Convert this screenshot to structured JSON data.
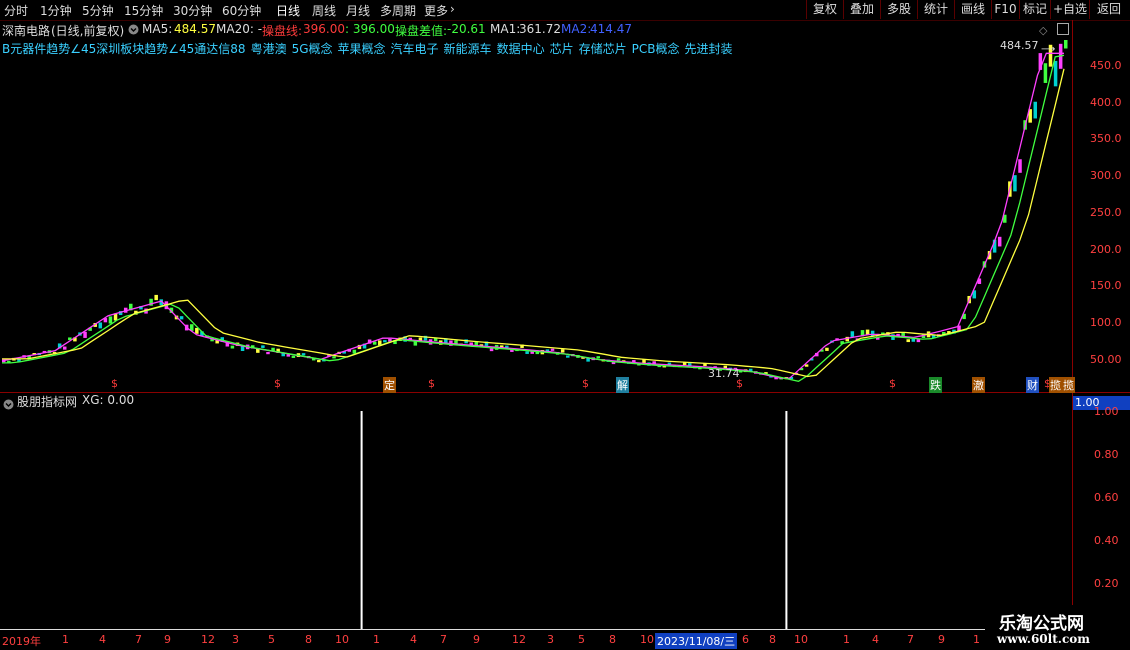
{
  "toolbar": {
    "periods": [
      "分时",
      "1分钟",
      "5分钟",
      "15分钟",
      "30分钟",
      "60分钟",
      "日线",
      "周线",
      "月线",
      "多周期",
      "更多"
    ],
    "more_arrow": "›",
    "buttons": [
      "复权",
      "叠加",
      "多股",
      "统计",
      "画线",
      "F10",
      "标记",
      "+自选",
      "返回"
    ]
  },
  "info": {
    "stock": "深南电路",
    "mode": "(日线,前复权)",
    "ma5_label": "MA5:",
    "ma5": "484.57",
    "ma20_label": "MA20: -",
    "cpl_label": "操盘线:",
    "cpl": "396.00",
    "cpl2": ": 396.00",
    "diff_label": "操盘差值:",
    "diff": "-20.61",
    "ma1_label": "MA1:",
    "ma1": "361.72",
    "ma2_label": "MA2:",
    "ma2": "414.47"
  },
  "concepts": [
    "B元器件趋势∠45深圳板块趋势∠45通达信88",
    "粤港澳",
    "5G概念",
    "苹果概念",
    "汽车电子",
    "新能源车",
    "数据中心",
    "芯片",
    "存储芯片",
    "PCB概念",
    "先进封装"
  ],
  "price_axis": [
    "450.0",
    "400.0",
    "350.0",
    "300.0",
    "250.0",
    "200.0",
    "150.0",
    "100.0",
    "50.00"
  ],
  "price_high": "484.57",
  "price_low": "31.74",
  "event_marks": [
    "$",
    "$",
    "定",
    "$",
    "$",
    "解",
    "$",
    "$",
    "跌",
    "澈",
    "财",
    "$",
    "揽",
    "揽"
  ],
  "indicator": {
    "name": "股朋指标网",
    "xg": "XG: 0.00",
    "axis": [
      "1.00",
      "0.80",
      "0.60",
      "0.40",
      "0.20"
    ],
    "current": "1.00"
  },
  "x_axis": [
    "2019年",
    "1",
    "4",
    "7",
    "9",
    "12",
    "3",
    "5",
    "8",
    "10",
    "1",
    "4",
    "7",
    "9",
    "12",
    "3",
    "5",
    "8",
    "10",
    "2023/11/08/三",
    "6",
    "8",
    "10",
    "1",
    "4",
    "7",
    "9",
    "1"
  ],
  "watermark": {
    "title": "乐淘公式网",
    "url": "www.60lt.com"
  },
  "colors": {
    "up": "#ff3b3b",
    "down": "#00d0d0",
    "ma_pink": "#ff40ff",
    "ma_green": "#40ff40",
    "ma_yellow": "#ffff40",
    "axis": "#ff4040",
    "grid": "#8a0000"
  },
  "chart_data": {
    "type": "line",
    "title": "深南电路 (日线,前复权)",
    "ylim": [
      31.74,
      484.57
    ],
    "series": [
      {
        "name": "price",
        "x": [
          0,
          5,
          10,
          15,
          18,
          22,
          26,
          30,
          36,
          42,
          48,
          52,
          56,
          60,
          66,
          70,
          74,
          78,
          82,
          86,
          90,
          94,
          98
        ],
        "values": [
          58,
          72,
          120,
          140,
          95,
          80,
          70,
          60,
          90,
          82,
          75,
          70,
          60,
          55,
          50,
          45,
          32,
          85,
          95,
          90,
          105,
          240,
          480
        ]
      }
    ],
    "signals": {
      "name": "XG",
      "x": [
        30,
        70
      ],
      "values": [
        1,
        1
      ]
    }
  }
}
